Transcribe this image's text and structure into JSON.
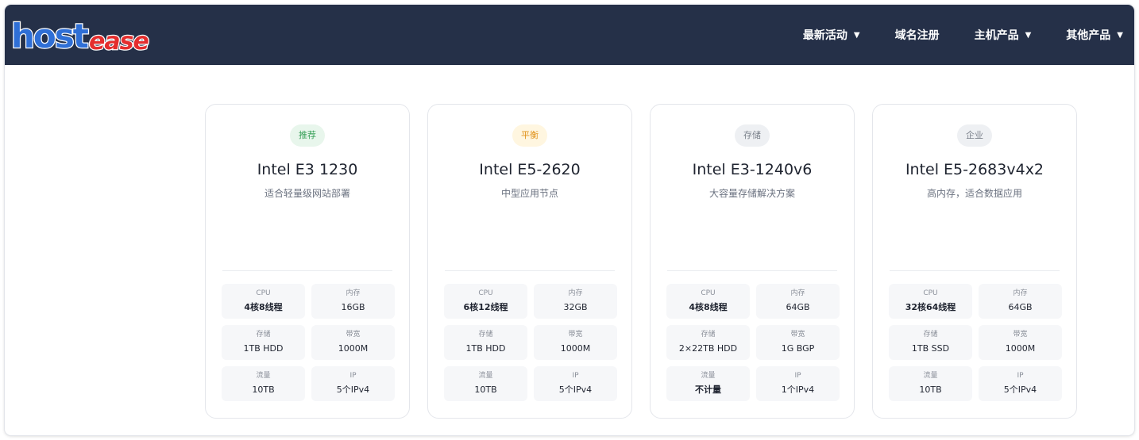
{
  "brand": {
    "name_part1": "host",
    "name_part2": "ease"
  },
  "nav": {
    "items": [
      {
        "label": "最新活动",
        "has_dropdown": true
      },
      {
        "label": "域名注册",
        "has_dropdown": false
      },
      {
        "label": "主机产品",
        "has_dropdown": true
      },
      {
        "label": "其他产品",
        "has_dropdown": true
      }
    ],
    "caret": "▼"
  },
  "colors": {
    "nav_bg": "#253048",
    "badge_recommend_bg": "#e8f6ec",
    "badge_recommend_fg": "#3aa15a",
    "badge_balance_bg": "#fff6e0",
    "badge_balance_fg": "#e0921a",
    "badge_storage_bg": "#eef0f3",
    "badge_storage_fg": "#7b818b",
    "badge_enterprise_bg": "#eef0f3",
    "badge_enterprise_fg": "#7b818b"
  },
  "cards": [
    {
      "badge": "推荐",
      "title": "Intel E3 1230",
      "subtitle": "适合轻量级网站部署",
      "specs": [
        {
          "label": "CPU",
          "value": "4核8线程"
        },
        {
          "label": "内存",
          "value": "16GB"
        },
        {
          "label": "存储",
          "value": "1TB HDD"
        },
        {
          "label": "带宽",
          "value": "1000M"
        },
        {
          "label": "流量",
          "value": "10TB"
        },
        {
          "label": "IP",
          "value": "5个IPv4"
        }
      ]
    },
    {
      "badge": "平衡",
      "title": "Intel E5-2620",
      "subtitle": "中型应用节点",
      "specs": [
        {
          "label": "CPU",
          "value": "6核12线程"
        },
        {
          "label": "内存",
          "value": "32GB"
        },
        {
          "label": "存储",
          "value": "1TB HDD"
        },
        {
          "label": "带宽",
          "value": "1000M"
        },
        {
          "label": "流量",
          "value": "10TB"
        },
        {
          "label": "IP",
          "value": "5个IPv4"
        }
      ]
    },
    {
      "badge": "存储",
      "title": "Intel E3-1240v6",
      "subtitle": "大容量存储解决方案",
      "specs": [
        {
          "label": "CPU",
          "value": "4核8线程"
        },
        {
          "label": "内存",
          "value": "64GB"
        },
        {
          "label": "存储",
          "value": "2×22TB HDD"
        },
        {
          "label": "带宽",
          "value": "1G BGP"
        },
        {
          "label": "流量",
          "value": "不计量"
        },
        {
          "label": "IP",
          "value": "1个IPv4"
        }
      ]
    },
    {
      "badge": "企业",
      "title": "Intel E5-2683v4x2",
      "subtitle": "高内存，适合数据应用",
      "specs": [
        {
          "label": "CPU",
          "value": "32核64线程"
        },
        {
          "label": "内存",
          "value": "64GB"
        },
        {
          "label": "存储",
          "value": "1TB SSD"
        },
        {
          "label": "带宽",
          "value": "1000M"
        },
        {
          "label": "流量",
          "value": "10TB"
        },
        {
          "label": "IP",
          "value": "5个IPv4"
        }
      ]
    }
  ]
}
